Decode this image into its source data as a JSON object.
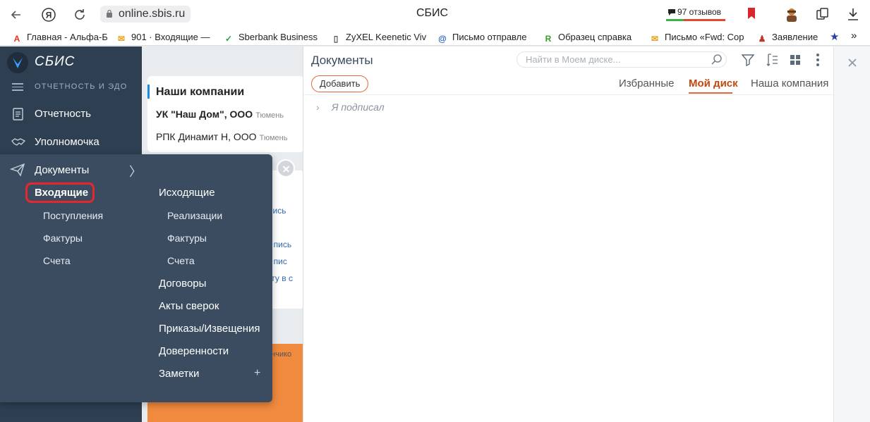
{
  "browser": {
    "url": "online.sbis.ru",
    "title": "СБИС",
    "reviews": "97 отзывов"
  },
  "bookmarks": [
    {
      "label": "Главная - Альфа-Б",
      "icon": "alfa-icon",
      "color": "#ef3124"
    },
    {
      "label": "901 · Входящие —",
      "icon": "gmail-icon",
      "color": "#e8a21a"
    },
    {
      "label": "Sberbank Business",
      "icon": "sber-icon",
      "color": "#21a038"
    },
    {
      "label": "ZyXEL Keenetic Viv",
      "icon": "page-icon",
      "color": "#555555"
    },
    {
      "label": "Письмо отправле",
      "icon": "mail-at-icon",
      "color": "#1f5fb8"
    },
    {
      "label": "Образец справка",
      "icon": "rub-icon",
      "color": "#3a9a2a"
    },
    {
      "label": "Письмо «Fwd: Cop",
      "icon": "gmail-icon",
      "color": "#e8a21a"
    },
    {
      "label": "Заявление",
      "icon": "person-icon",
      "color": "#c0392b"
    }
  ],
  "sidebar": {
    "logo": "СБИС",
    "subtitle": "ОТЧЕТНОСТЬ И ЭДО",
    "items": [
      {
        "label": "Отчетность",
        "icon": "report-icon"
      },
      {
        "label": "Уполномочка",
        "icon": "handshake-icon"
      }
    ]
  },
  "flyout": {
    "header": "Документы",
    "incoming": {
      "label": "Входящие",
      "children": [
        "Поступления",
        "Фактуры",
        "Счета"
      ]
    },
    "outgoing": {
      "label": "Исходящие",
      "children": [
        "Реализации",
        "Фактуры",
        "Счета"
      ]
    },
    "others": [
      "Договоры",
      "Акты сверок",
      "Приказы/Извещения",
      "Доверенности",
      "Заметки"
    ]
  },
  "background": {
    "companies_title": "Наши компании",
    "companies": [
      {
        "name": "УК \"Наш Дом\", ООО",
        "city": "Тюмень",
        "bold": true
      },
      {
        "name": "РПК Динамит Н, ООО",
        "city": "Тюмень",
        "bold": false
      }
    ],
    "fragments": [
      "пись",
      "ее пись",
      "ее пис",
      "енту в с"
    ],
    "orange_fragment": "фончико"
  },
  "docs": {
    "title": "Документы",
    "search_placeholder": "Найти в Моем диске...",
    "add_label": "Добавить",
    "tabs": [
      {
        "label": "Избранные",
        "active": false
      },
      {
        "label": "Мой диск",
        "active": true
      },
      {
        "label": "Наша компания",
        "active": false
      }
    ],
    "folders": [
      "Я подписал"
    ]
  },
  "colors": {
    "sidebar": "#2e3f52",
    "flyout": "#3b4c60",
    "accent": "#e06a3a",
    "highlight": "#e8262e"
  }
}
